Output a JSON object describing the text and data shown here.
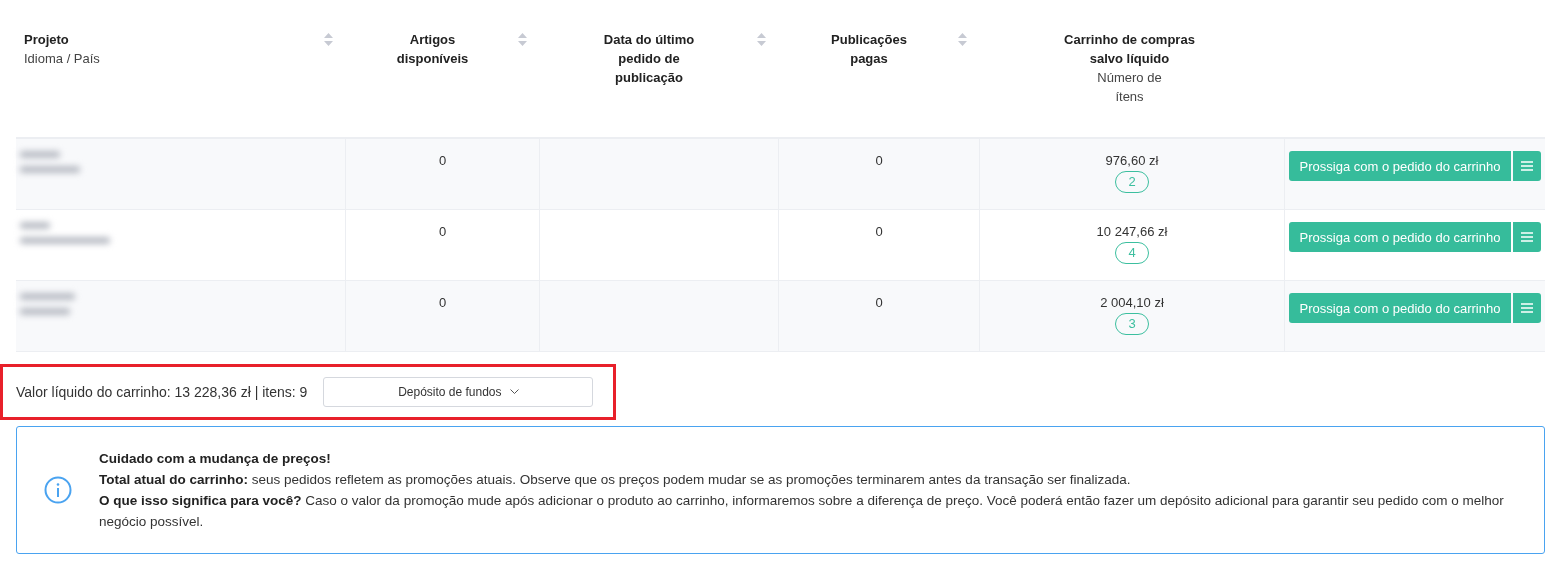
{
  "table": {
    "columns": [
      {
        "title": "Projeto",
        "subtitle": "Idioma / País",
        "sortable": true
      },
      {
        "title": "Artigos disponíveis",
        "sortable": true
      },
      {
        "title": "Data do último pedido de publicação",
        "sortable": true
      },
      {
        "title": "Publicações pagas",
        "sortable": true
      },
      {
        "title": "Carrinho de compras salvo líquido",
        "subtitle": "Número de ítens",
        "sortable": false
      }
    ],
    "rows": [
      {
        "articles": "0",
        "paid": "0",
        "cart_value": "976,60 zł",
        "items": "2",
        "action": "Prossiga com o pedido do carrinho"
      },
      {
        "articles": "0",
        "paid": "0",
        "cart_value": "10 247,66 zł",
        "items": "4",
        "action": "Prossiga com o pedido do carrinho"
      },
      {
        "articles": "0",
        "paid": "0",
        "cart_value": "2 004,10 zł",
        "items": "3",
        "action": "Prossiga com o pedido do carrinho"
      }
    ]
  },
  "summary": {
    "text": "Valor líquido do carrinho: 13 228,36 zł | itens: 9",
    "highlighted": true,
    "deposit_button": "Depósito de fundos"
  },
  "notice": {
    "title": "Cuidado com a mudança de preços!",
    "lines": [
      "**Total atual do carrinho:** seus pedidos refletem as promoções atuais. Observe que os preços podem mudar se as promoções terminarem antes da transação ser finalizada.",
      "**O que isso significa para você?** Caso o valor da promoção mude após adicionar o produto ao carrinho, informaremos sobre a diferença de preço. Você poderá então fazer um depósito adicional para garantir seu pedido com o melhor negócio possível."
    ]
  }
}
